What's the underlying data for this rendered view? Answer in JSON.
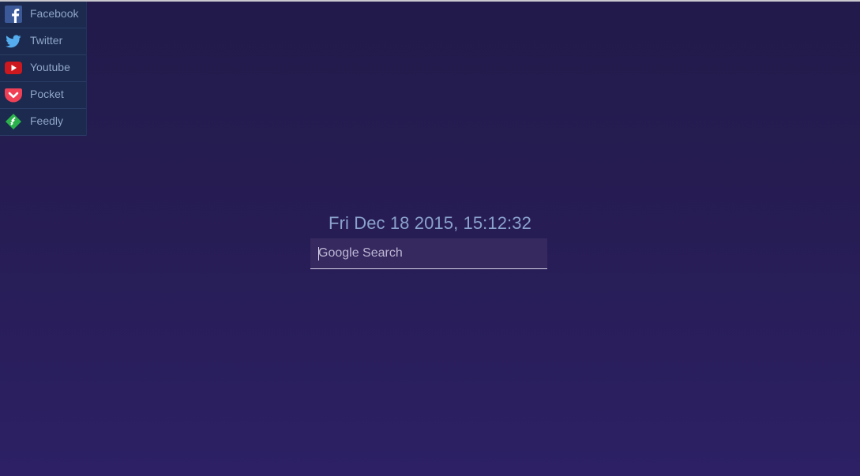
{
  "sidebar": {
    "items": [
      {
        "label": "Facebook",
        "icon": "facebook-icon",
        "color": "#3b5998"
      },
      {
        "label": "Twitter",
        "icon": "twitter-icon",
        "color": "#55acee"
      },
      {
        "label": "Youtube",
        "icon": "youtube-icon",
        "color": "#cc181e"
      },
      {
        "label": "Pocket",
        "icon": "pocket-icon",
        "color": "#ef4056"
      },
      {
        "label": "Feedly",
        "icon": "feedly-icon",
        "color": "#2bb24c"
      }
    ]
  },
  "clock": {
    "text": "Fri Dec 18 2015, 15:12:32"
  },
  "search": {
    "placeholder": "Google Search",
    "value": ""
  }
}
